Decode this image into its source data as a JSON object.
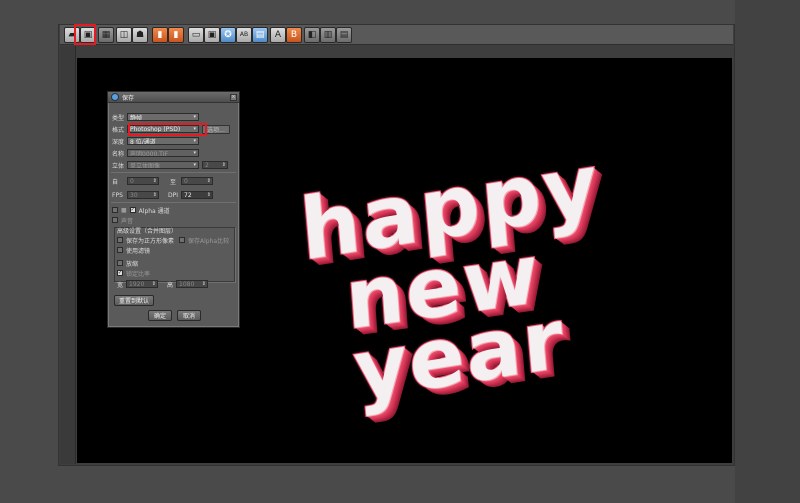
{
  "toolbar": {
    "buttons": [
      {
        "icon": "open-folder-icon",
        "glyph": "▰"
      },
      {
        "icon": "save-icon",
        "glyph": "▣"
      },
      {
        "icon": "grid-icon",
        "glyph": "▦"
      },
      {
        "icon": "render-region-icon",
        "glyph": "◫"
      },
      {
        "icon": "teapot-icon",
        "glyph": "☗"
      },
      {
        "icon": "render-icon",
        "glyph": "▮"
      },
      {
        "icon": "render-active-icon",
        "glyph": "▮"
      },
      {
        "icon": "clone-icon",
        "glyph": "▭"
      },
      {
        "icon": "viewport-render-icon",
        "glyph": "▣"
      },
      {
        "icon": "settings-icon",
        "glyph": "✪"
      },
      {
        "icon": "ab-compare-icon",
        "glyph": "AB"
      },
      {
        "icon": "histogram-icon",
        "glyph": "▤"
      },
      {
        "icon": "channel-a-icon",
        "glyph": "A"
      },
      {
        "icon": "channel-b-icon",
        "glyph": "B"
      },
      {
        "icon": "split-icon",
        "glyph": "◧"
      },
      {
        "icon": "film-icon",
        "glyph": "▥"
      },
      {
        "icon": "layers-icon",
        "glyph": "▤"
      }
    ]
  },
  "scene": {
    "line1": "happy",
    "line2": "new",
    "line3": "year"
  },
  "dialog": {
    "title": "保存",
    "close": "×",
    "type_label": "类型",
    "type_value": "静帧",
    "format_label": "格式",
    "format_value": "Photoshop (PSD)",
    "options_button": "选项...",
    "depth_label": "深度",
    "depth_value": "8 位/通道",
    "name_label": "名称",
    "name_value": "声明0000.TIF",
    "stereo_label": "立体",
    "stereo_value": "单立体图像",
    "stereo_num": "2",
    "from_label": "自",
    "from_value": "0",
    "to_label": "至",
    "to_value": "0",
    "fps_label": "FPS",
    "fps_value": "30",
    "dpi_label": "DPI",
    "dpi_value": "72",
    "alpha_label": "Alpha 通道",
    "sound_label": "声音",
    "advanced_label": "高级设置（合并图层）",
    "save_square_label": "保存为正方形像素",
    "save_alpha_label": "保存Alpha比较",
    "use_filter_label": "使用滤镜",
    "zoom_label": "放缩",
    "lock_ratio_label": "锁定比率",
    "width_label": "宽",
    "width_value": "1920",
    "height_label": "高",
    "height_value": "1080",
    "reset_button": "重置到默认",
    "ok_button": "确定",
    "cancel_button": "取消"
  },
  "colors": {
    "highlight": "#e31b23",
    "text_face": "#f4f0f2",
    "text_side": "#d8375a",
    "background": "#000000"
  }
}
